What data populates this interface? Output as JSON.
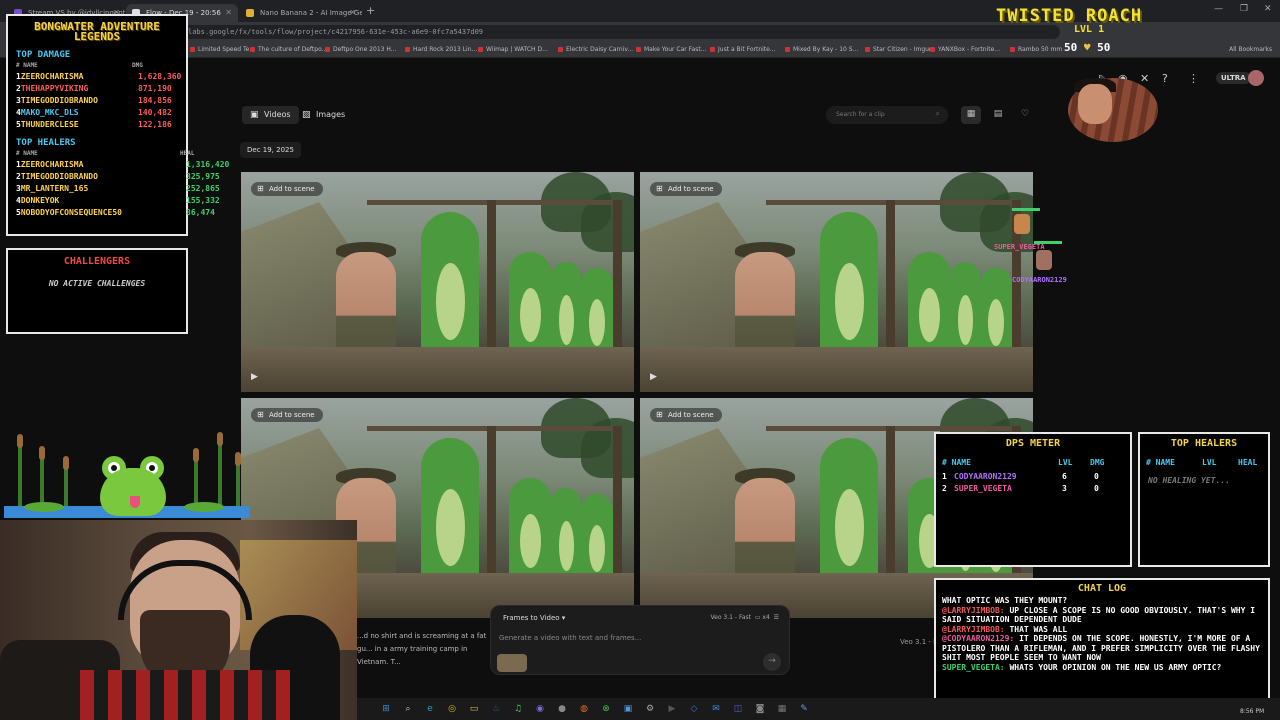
{
  "browser": {
    "tabs": [
      {
        "label": "Stream VS by @idyllcingent",
        "active": false
      },
      {
        "label": "Flow - Dec 19 - 20:56",
        "active": true
      },
      {
        "label": "Nano Banana 2 - AI Image Gen",
        "active": false
      }
    ],
    "url": "labs.google/fx/tools/flow/project/c4217956-631e-453c-a6e9-0fc7a5437d09",
    "bookmarks": [
      "Limited Speed Te...",
      "The culture of Deftpo...",
      "Deftpo One 2013 H...",
      "Hard Rock 2013 Lin...",
      "Wiimap | WATCH D...",
      "Electric Daisy Carniv...",
      "Make Your Car Fast...",
      "Just a Bit Fortnite...",
      "Mixed By Kay - 10 S...",
      "Star Citizen - Imgur",
      "YANXBox - Fortnite...",
      "Rambo 50 mm"
    ],
    "all_bookmarks": "All Bookmarks"
  },
  "app": {
    "tier_badge": "ULTRA",
    "tabs": [
      {
        "label": "Videos",
        "icon": "video-icon"
      },
      {
        "label": "Images",
        "icon": "image-icon"
      }
    ],
    "search_placeholder": "Search for a clip",
    "date_chip": "Dec 19, 2025",
    "add_to_scene": "Add to scene",
    "prompt": {
      "mode": "Frames to Video",
      "model": "Veo 3.1 - Fast",
      "count": "x4",
      "placeholder": "Generate a video with text and frames..."
    },
    "caption": "...d no shirt and is screaming at a fat gu... in a army training camp in Vietnam. T...",
    "veo_label": "Veo 3.1 - F"
  },
  "leaderboard": {
    "title_line1": "BONGWATER ADVENTURE",
    "title_line2": "LEGENDS",
    "damage_heading": "TOP DAMAGE",
    "healers_heading": "TOP HEALERS",
    "col_name": "# NAME",
    "col_dmg": "DMG",
    "col_heal": "HEAL",
    "damage": [
      {
        "rank": "1",
        "name": "ZEEROCHARISMA",
        "value": "1,628,360",
        "color": "#ffd24a"
      },
      {
        "rank": "2",
        "name": "THEHAPPYVIKING",
        "value": "871,190",
        "color": "#ff5a5a"
      },
      {
        "rank": "3",
        "name": "TIMEGODDIOBRANDO",
        "value": "184,856",
        "color": "#ffd24a"
      },
      {
        "rank": "4",
        "name": "MAKO_MKC_DLS",
        "value": "140,482",
        "color": "#48c8f0"
      },
      {
        "rank": "5",
        "name": "THUNDERCLESE",
        "value": "122,186",
        "color": "#ffd24a"
      }
    ],
    "healers": [
      {
        "rank": "1",
        "name": "ZEEROCHARISMA",
        "value": "1,316,420",
        "color": "#ffd24a"
      },
      {
        "rank": "2",
        "name": "TIMEGODDIOBRANDO",
        "value": "325,975",
        "color": "#ffd24a"
      },
      {
        "rank": "3",
        "name": "MR_LANTERN_165",
        "value": "252,865",
        "color": "#ffd24a"
      },
      {
        "rank": "4",
        "name": "DONKEYOK",
        "value": "155,332",
        "color": "#ffd24a"
      },
      {
        "rank": "5",
        "name": "NOBODYOFCONSEQUENCE50",
        "value": "86,474",
        "color": "#ffd24a"
      }
    ]
  },
  "challengers": {
    "title": "CHALLENGERS",
    "status": "NO ACTIVE CHALLENGES"
  },
  "boss": {
    "title": "TWISTED ROACH",
    "level": "LVL 1",
    "hp_left": "50",
    "hp_right": "50"
  },
  "sprites": [
    {
      "name": "SUPER_VEGETA",
      "color": "#f05aa0"
    },
    {
      "name": "CODYAARON2129",
      "color": "#b070ff"
    }
  ],
  "dps": {
    "title": "DPS METER",
    "col_name": "# NAME",
    "col_lvl": "LVL",
    "col_dmg": "DMG",
    "rows": [
      {
        "rank": "1",
        "name": "CODYAARON2129",
        "lvl": "6",
        "dmg": "0",
        "color": "#b070ff"
      },
      {
        "rank": "2",
        "name": "SUPER_VEGETA",
        "lvl": "3",
        "dmg": "0",
        "color": "#f05aa0"
      }
    ]
  },
  "top_healers_panel": {
    "title": "TOP HEALERS",
    "col_name": "# NAME",
    "col_lvl": "LVL",
    "col_heal": "HEAL",
    "empty": "NO HEALING YET..."
  },
  "chat": {
    "title": "CHAT LOG",
    "messages": [
      {
        "user": "",
        "text": "WHAT OPTIC WAS THEY MOUNT?"
      },
      {
        "user": "@LARRYJIMBOB:",
        "text": "UP CLOSE A SCOPE IS NO GOOD OBVIOUSLY. THAT'S WHY I SAID SITUATION DEPENDENT DUDE",
        "color": "#f05a5a"
      },
      {
        "user": "@LARRYJIMBOB:",
        "text": "THAT WAS ALL",
        "color": "#f05a5a"
      },
      {
        "user": "@CODYAARON2129:",
        "text": "IT DEPENDS ON THE SCOPE. HONESTLY, I'M MORE OF A PISTOLERO THAN A RIFLEMAN, AND I PREFER SIMPLICITY OVER THE FLASHY SHIT MOST PEOPLE SEEM TO WANT NOW",
        "color": "#f05aa0"
      },
      {
        "user": "SUPER_VEGETA:",
        "text": "WHATS YOUR OPINION ON THE NEW US ARMY OPTIC?",
        "color": "#3ed06a"
      }
    ]
  },
  "taskbar": {
    "icons": [
      "windows-icon",
      "search-icon",
      "edge-icon",
      "chrome-icon",
      "explorer-icon",
      "steam-icon",
      "spotify-icon",
      "discord-icon",
      "obs-icon",
      "firefox-icon",
      "xbox-icon",
      "photos-icon",
      "settings-icon",
      "terminal-icon",
      "vscode-icon",
      "mail-icon",
      "store-icon",
      "camera-icon",
      "calc-icon",
      "notepad-icon"
    ],
    "clock": "8:56 PM"
  }
}
